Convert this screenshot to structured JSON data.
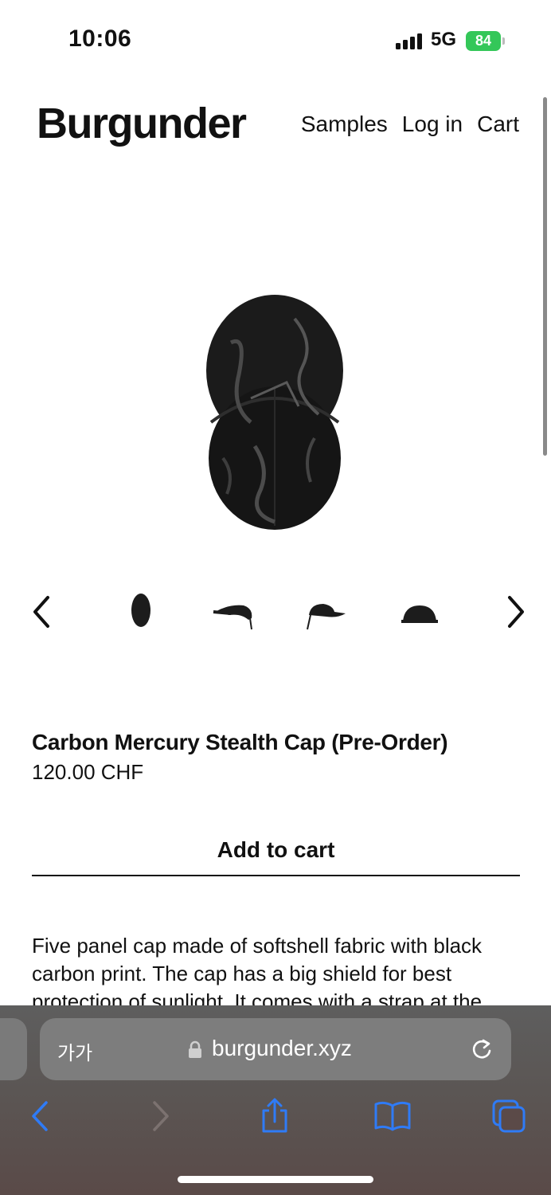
{
  "status_bar": {
    "time": "10:06",
    "network": "5G",
    "battery": "84"
  },
  "header": {
    "logo": "Burgunder",
    "nav": [
      "Samples",
      "Log in",
      "Cart"
    ]
  },
  "product": {
    "title": "Carbon Mercury Stealth Cap (Pre-Order)",
    "price": "120.00 CHF",
    "add_to_cart_label": "Add to cart",
    "description": "Five panel cap made of softshell fabric with black carbon print. The cap has a big shield for best protection of sunlight. It comes with a strap at the"
  },
  "browser": {
    "text_size_label": "가가",
    "url": "burgunder.xyz"
  },
  "icons": {
    "thumb_prev": "chevron-left-icon",
    "thumb_next": "chevron-right-icon",
    "lock": "lock-icon",
    "reload": "reload-icon",
    "back": "back-icon",
    "forward": "forward-icon",
    "share": "share-icon",
    "bookmarks": "book-icon",
    "tabs": "tabs-icon"
  },
  "colors": {
    "battery": "#34c759",
    "safari_accent": "#2f7bf6"
  }
}
